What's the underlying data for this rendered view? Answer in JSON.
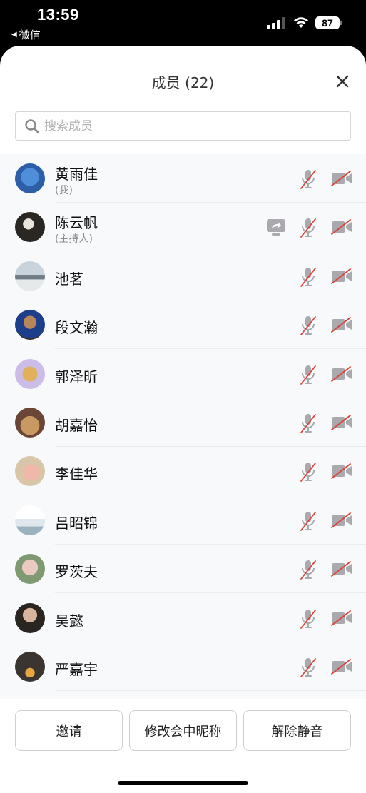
{
  "status_bar": {
    "time": "13:59",
    "back_app": "微信",
    "battery": "87"
  },
  "sheet": {
    "title": "成员 (22)",
    "close_icon": "close-icon"
  },
  "search": {
    "placeholder": "搜索成员",
    "value": ""
  },
  "members": [
    {
      "name": "黄雨佳",
      "sub": "(我)",
      "mic": "muted",
      "cam": "off",
      "sharing": false
    },
    {
      "name": "陈云帆",
      "sub": "(主持人)",
      "mic": "muted",
      "cam": "off",
      "sharing": true
    },
    {
      "name": "池茗",
      "sub": "",
      "mic": "muted",
      "cam": "off",
      "sharing": false
    },
    {
      "name": "段文瀚",
      "sub": "",
      "mic": "muted",
      "cam": "off",
      "sharing": false
    },
    {
      "name": "郭泽昕",
      "sub": "",
      "mic": "muted",
      "cam": "off",
      "sharing": false
    },
    {
      "name": "胡嘉怡",
      "sub": "",
      "mic": "muted",
      "cam": "off",
      "sharing": false
    },
    {
      "name": "李佳华",
      "sub": "",
      "mic": "muted",
      "cam": "off",
      "sharing": false
    },
    {
      "name": "吕昭锦",
      "sub": "",
      "mic": "muted",
      "cam": "off",
      "sharing": false
    },
    {
      "name": "罗茨夫",
      "sub": "",
      "mic": "muted",
      "cam": "off",
      "sharing": false
    },
    {
      "name": "吴懿",
      "sub": "",
      "mic": "muted",
      "cam": "off",
      "sharing": false
    },
    {
      "name": "严嘉宇",
      "sub": "",
      "mic": "muted",
      "cam": "off",
      "sharing": false
    }
  ],
  "footer": {
    "invite": "邀请",
    "rename": "修改会中昵称",
    "unmute": "解除静音"
  },
  "colors": {
    "muted_slash": "#e0403a",
    "icon_gray": "#a9a9ae",
    "divider": "#ececec"
  }
}
